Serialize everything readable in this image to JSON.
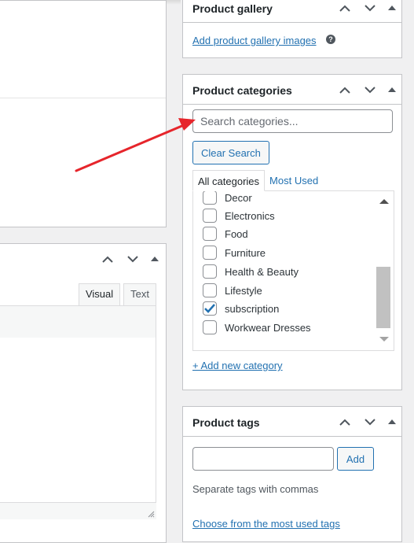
{
  "colors": {
    "link": "#2271b1",
    "border": "#c3c4c7",
    "annotation": "#e6252b",
    "bg": "#f0f0f1"
  },
  "editor": {
    "tabs": [
      "Visual",
      "Text"
    ]
  },
  "gallery": {
    "title": "Product gallery",
    "add_link": "Add product gallery images",
    "help_icon": "?"
  },
  "categories": {
    "title": "Product categories",
    "search_placeholder": "Search categories...",
    "clear_button": "Clear Search",
    "tabs": [
      "All categories",
      "Most Used"
    ],
    "items": [
      {
        "label": "Decor",
        "checked": false
      },
      {
        "label": "Electronics",
        "checked": false
      },
      {
        "label": "Food",
        "checked": false
      },
      {
        "label": "Furniture",
        "checked": false
      },
      {
        "label": "Health & Beauty",
        "checked": false
      },
      {
        "label": "Lifestyle",
        "checked": false
      },
      {
        "label": "subscription",
        "checked": true
      },
      {
        "label": "Workwear Dresses",
        "checked": false
      }
    ],
    "add_new": "+ Add new category"
  },
  "tags": {
    "title": "Product tags",
    "add_button": "Add",
    "help": "Separate tags with commas",
    "choose_link": "Choose from the most used tags"
  }
}
